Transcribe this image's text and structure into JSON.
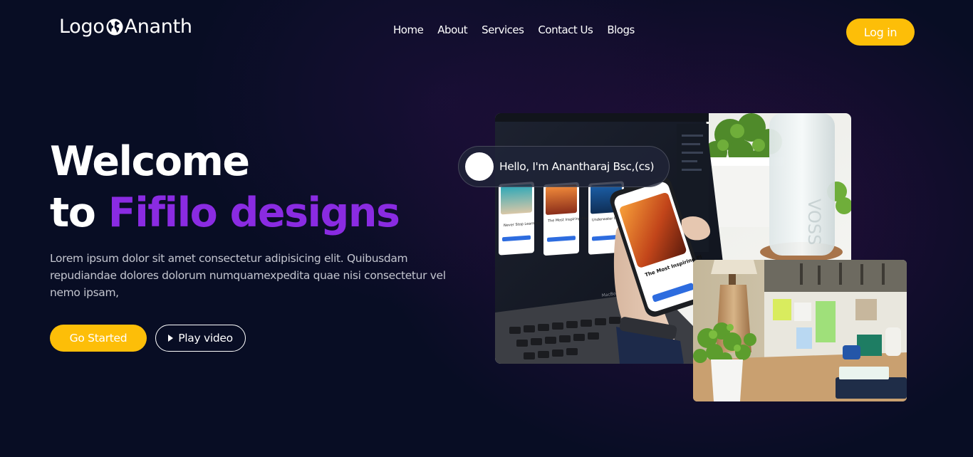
{
  "header": {
    "logo_prefix": "Logo",
    "logo_name": "Ananth",
    "logo_icon": "globe-icon",
    "nav": [
      "Home",
      "About",
      "Services",
      "Contact Us",
      "Blogs"
    ],
    "login_label": "Log in"
  },
  "hero": {
    "title_line1": "Welcome",
    "title_line2_prefix": "to",
    "title_line2_accent": "Fifilo designs",
    "description": "Lorem ipsum dolor sit amet consectetur adipisicing elit. Quibusdam repudiandae dolores dolorum numquamexpedita quae nisi consectetur vel nemo ipsam,",
    "primary_button": "Go Started",
    "secondary_button": "Play video",
    "secondary_button_icon": "play-icon"
  },
  "greeting": {
    "text": "Hello, I'm Anantharaj Bsc,(cs)"
  },
  "images": {
    "main_photo_texts": [
      "Never Stop Learning",
      "The Most Inspiring Places",
      "Underwater Photo Collection",
      "The Most Inspiring Pl",
      "MacBook Pro",
      "VOSS"
    ]
  },
  "colors": {
    "background": "#080d24",
    "accent": "#8a2be2",
    "button": "#fdbe08",
    "text_muted": "#c3c5cf"
  }
}
